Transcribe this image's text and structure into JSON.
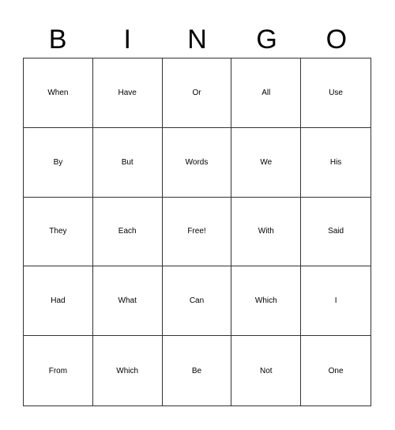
{
  "header": [
    "B",
    "I",
    "N",
    "G",
    "O"
  ],
  "cells": [
    [
      "When",
      "Have",
      "Or",
      "All",
      "Use"
    ],
    [
      "By",
      "But",
      "Words",
      "We",
      "His"
    ],
    [
      "They",
      "Each",
      "Free!",
      "With",
      "Said"
    ],
    [
      "Had",
      "What",
      "Can",
      "Which",
      "I"
    ],
    [
      "From",
      "Which",
      "Be",
      "Not",
      "One"
    ]
  ]
}
